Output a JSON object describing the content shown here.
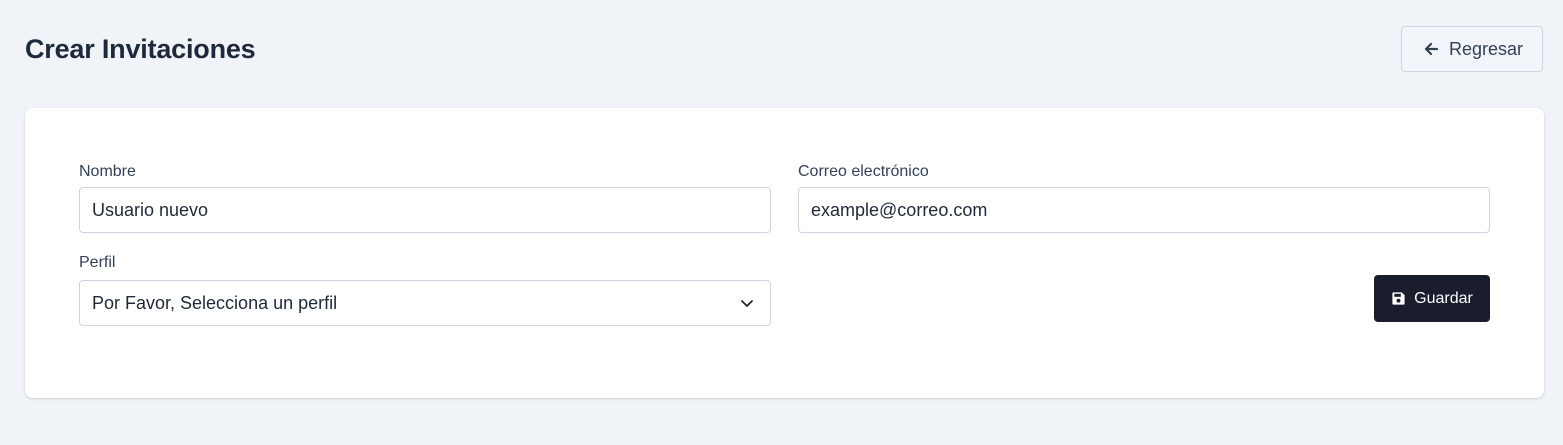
{
  "header": {
    "title": "Crear Invitaciones",
    "back_label": "Regresar",
    "back_icon": "arrow-left-icon"
  },
  "form": {
    "name": {
      "label": "Nombre",
      "value": "Usuario nuevo"
    },
    "email": {
      "label": "Correo electrónico",
      "value": "example@correo.com"
    },
    "profile": {
      "label": "Perfil",
      "selected": "Por Favor, Selecciona un perfil",
      "icon": "chevron-down-icon"
    },
    "save": {
      "label": "Guardar",
      "icon": "floppy-disk-icon"
    }
  },
  "colors": {
    "page_background": "#f0f4f8",
    "card_background": "#ffffff",
    "primary_button": "#1a1d2e",
    "title_text": "#1e293b",
    "input_border": "#cbd5e1"
  }
}
